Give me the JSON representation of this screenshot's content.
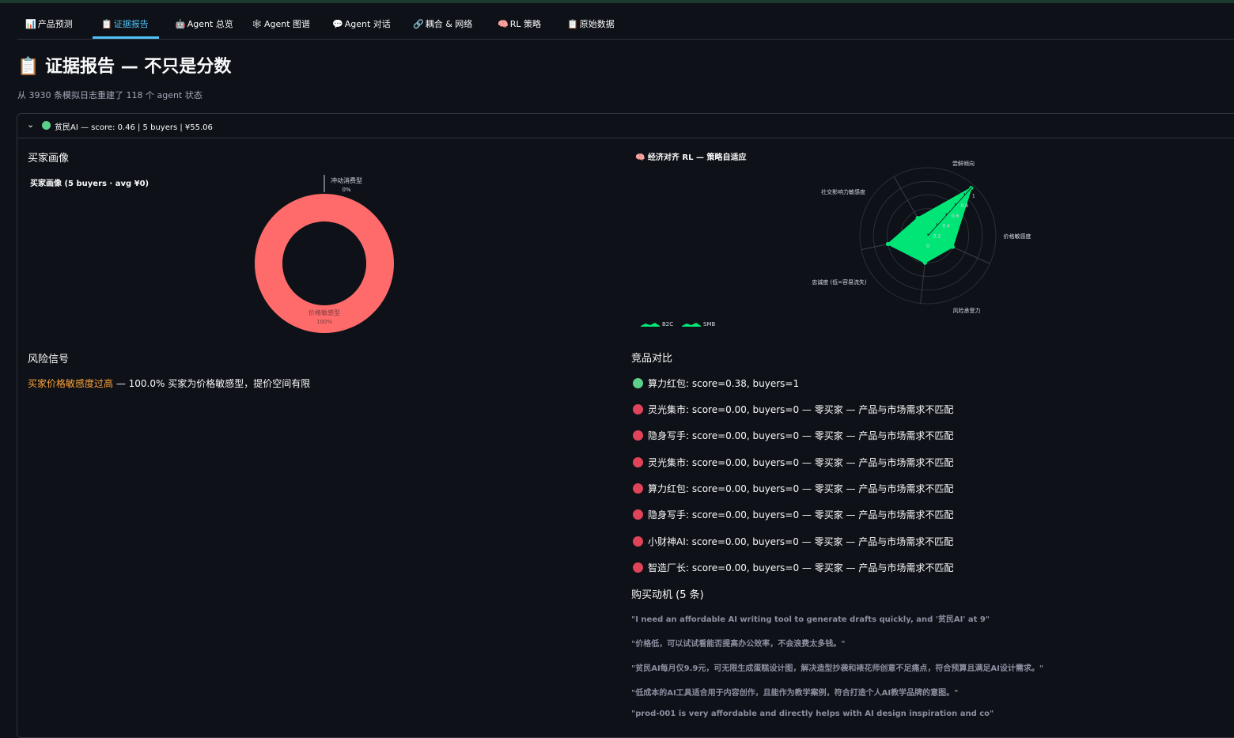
{
  "tabs": [
    {
      "icon": "📊",
      "label": "产品预测"
    },
    {
      "icon": "📋",
      "label": "证据报告"
    },
    {
      "icon": "🤖",
      "label": "Agent 总览"
    },
    {
      "icon": "🕸",
      "label": "Agent 图谱"
    },
    {
      "icon": "💬",
      "label": "Agent 对话"
    },
    {
      "icon": "🔗",
      "label": "耦合 & 网络"
    },
    {
      "icon": "🧠",
      "label": "RL 策略"
    },
    {
      "icon": "📋",
      "label": "原始数据"
    }
  ],
  "page": {
    "title": "📋 证据报告 — 不只是分数",
    "subtitle": "从 3930 条模拟日志重建了 118 个 agent 状态"
  },
  "expander": {
    "label": "贫民AI — score: 0.46 | 5 buyers | ¥55.06"
  },
  "sections": {
    "buyer_profile": "买家画像",
    "risk": "风险信号",
    "competitors": "竞品对比",
    "motives": "购买动机 (5 条)"
  },
  "donut_chart": {
    "title": "买家画像 (5 buyers · avg ¥0)",
    "labels": [
      {
        "name": "冲动消费型",
        "pct": "0%"
      },
      {
        "name": "价格敏感型",
        "pct": "100%"
      }
    ]
  },
  "radar_chart": {
    "title": "🧠 经济对齐 RL — 策略自适应",
    "axes": [
      "尝鲜倾向",
      "价格敏感度",
      "风险承受力",
      "忠诚度 (低=容易流失)",
      "社交影响力敏感度"
    ],
    "ticks": [
      "0",
      "0.2",
      "0.4",
      "0.6",
      "0.8",
      "1"
    ],
    "legend": [
      "B2C",
      "SMB"
    ]
  },
  "chart_data": [
    {
      "type": "pie",
      "title": "买家画像 (5 buyers · avg ¥0)",
      "categories": [
        "价格敏感型",
        "冲动消费型"
      ],
      "values": [
        100,
        0
      ],
      "colors": [
        "#ff6b6b",
        "#ffffff"
      ]
    },
    {
      "type": "radar",
      "title": "🧠 经济对齐 RL — 策略自适应",
      "categories": [
        "尝鲜倾向",
        "价格敏感度",
        "风险承受力",
        "忠诚度 (低=容易流失)",
        "社交影响力敏感度"
      ],
      "range": [
        0,
        1
      ],
      "series": [
        {
          "name": "B2C",
          "values": [
            0.3,
            0.95,
            0.4,
            0.4,
            0.6
          ],
          "color": "#00e676"
        },
        {
          "name": "SMB",
          "values": [
            0.3,
            0.95,
            0.4,
            0.4,
            0.6
          ],
          "color": "#00e676"
        }
      ]
    }
  ],
  "risk": {
    "key": "买家价格敏感度过高",
    "desc": " — 100.0% 买家为价格敏感型，提价空间有限"
  },
  "competitors": [
    {
      "status": "green",
      "text": "算力红包: score=0.38, buyers=1"
    },
    {
      "status": "red",
      "text": "灵光集市: score=0.00, buyers=0 — 零买家 — 产品与市场需求不匹配"
    },
    {
      "status": "red",
      "text": "隐身写手: score=0.00, buyers=0 — 零买家 — 产品与市场需求不匹配"
    },
    {
      "status": "red",
      "text": "灵光集市: score=0.00, buyers=0 — 零买家 — 产品与市场需求不匹配"
    },
    {
      "status": "red",
      "text": "算力红包: score=0.00, buyers=0 — 零买家 — 产品与市场需求不匹配"
    },
    {
      "status": "red",
      "text": "隐身写手: score=0.00, buyers=0 — 零买家 — 产品与市场需求不匹配"
    },
    {
      "status": "red",
      "text": "小财神AI: score=0.00, buyers=0 — 零买家 — 产品与市场需求不匹配"
    },
    {
      "status": "red",
      "text": "智造厂长: score=0.00, buyers=0 — 零买家 — 产品与市场需求不匹配"
    }
  ],
  "status_colors": {
    "green": "#5bd08a",
    "red": "#e0435a"
  },
  "motives": [
    "\"I need an affordable AI writing tool to generate drafts quickly, and '贫民AI' at 9\"",
    "\"价格低，可以试试看能否提高办公效率，不会浪费太多钱。\"",
    "\"贫民AI每月仅9.9元，可无限生成蛋糕设计图，解决造型抄袭和裱花师创意不足痛点，符合预算且满足AI设计需求。\"",
    "\"低成本的AI工具适合用于内容创作，且能作为教学案例，符合打造个人AI教学品牌的意图。\"",
    "\"prod-001 is very affordable and directly helps with AI design inspiration and co\""
  ]
}
